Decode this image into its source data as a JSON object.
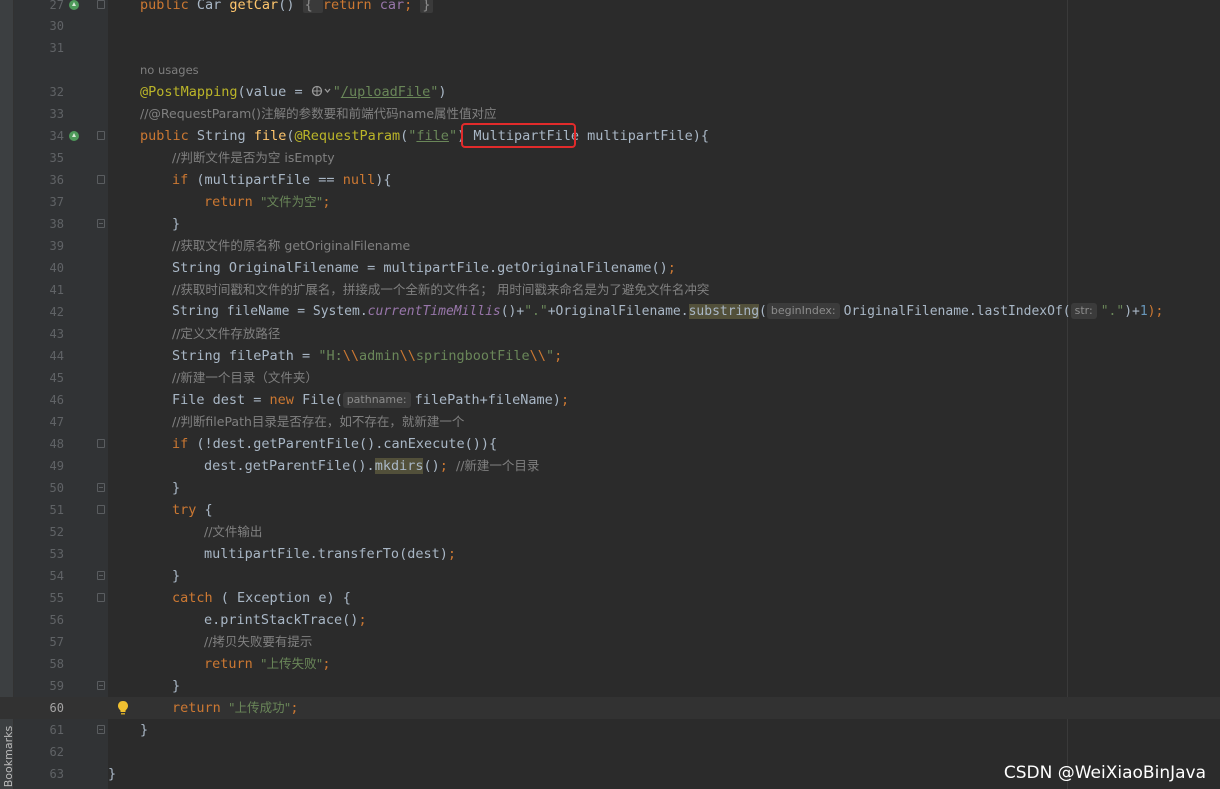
{
  "sidebar": {
    "bookmarks_label": "Bookmarks"
  },
  "code": {
    "usage_hint": "no usages",
    "lines": [
      {
        "num": "27",
        "text": "public Car getCar() { return car; }"
      },
      {
        "num": "30",
        "text": ""
      },
      {
        "num": "31",
        "text": ""
      },
      {
        "num": "32",
        "text": "@PostMapping(value = \"/uploadFile\")"
      },
      {
        "num": "33",
        "text": "//@RequestParam()注解的参数要和前端代码name属性值对应"
      },
      {
        "num": "34",
        "text": "public String file(@RequestParam(\"file\") MultipartFile multipartFile){"
      },
      {
        "num": "35",
        "text": "//判断文件是否为空 isEmpty"
      },
      {
        "num": "36",
        "text": "if (multipartFile == null){"
      },
      {
        "num": "37",
        "text": "return \"文件为空\";"
      },
      {
        "num": "38",
        "text": "}"
      },
      {
        "num": "39",
        "text": "//获取文件的原名称 getOriginalFilename"
      },
      {
        "num": "40",
        "text": "String OriginalFilename = multipartFile.getOriginalFilename();"
      },
      {
        "num": "41",
        "text": "//获取时间戳和文件的扩展名，拼接成一个全新的文件名； 用时间戳来命名是为了避免文件名冲突"
      },
      {
        "num": "42",
        "text": "String fileName = System.currentTimeMillis()+\".\"+OriginalFilename.substring(beginIndex: OriginalFilename.lastIndexOf(str: \".\")+1);"
      },
      {
        "num": "43",
        "text": "//定义文件存放路径"
      },
      {
        "num": "44",
        "text": "String filePath = \"H:\\\\admin\\\\springbootFile\\\\\";"
      },
      {
        "num": "45",
        "text": "//新建一个目录（文件夹）"
      },
      {
        "num": "46",
        "text": "File dest = new File(pathname: filePath+fileName);"
      },
      {
        "num": "47",
        "text": "//判断filePath目录是否存在，如不存在，就新建一个"
      },
      {
        "num": "48",
        "text": "if (!dest.getParentFile().canExecute()){"
      },
      {
        "num": "49",
        "text": "dest.getParentFile().mkdirs(); //新建一个目录"
      },
      {
        "num": "50",
        "text": "}"
      },
      {
        "num": "51",
        "text": "try {"
      },
      {
        "num": "52",
        "text": "//文件输出"
      },
      {
        "num": "53",
        "text": "multipartFile.transferTo(dest);"
      },
      {
        "num": "54",
        "text": "}"
      },
      {
        "num": "55",
        "text": "catch ( Exception e) {"
      },
      {
        "num": "56",
        "text": "e.printStackTrace();"
      },
      {
        "num": "57",
        "text": "//拷贝失败要有提示"
      },
      {
        "num": "58",
        "text": "return \"上传失败\";"
      },
      {
        "num": "59",
        "text": "}"
      },
      {
        "num": "60",
        "text": "return \"上传成功\";"
      },
      {
        "num": "61",
        "text": "}"
      },
      {
        "num": "62",
        "text": ""
      },
      {
        "num": "63",
        "text": "}"
      }
    ]
  },
  "tokens": {
    "l27": {
      "a": "public ",
      "b": "Car ",
      "c": "getCar",
      "d": "() ",
      "e": "{ ",
      "f": "return ",
      "g": "car",
      "h": "; ",
      "i": "}"
    },
    "l32": {
      "a": "@PostMapping",
      "b": "(value = ",
      "c": "\"",
      "d": "/uploadFile",
      "e": "\"",
      "f": ")"
    },
    "l33": {
      "a": "//@RequestParam()注解的参数要和前端代码name属性值对应"
    },
    "l34": {
      "a": "public ",
      "b": "String ",
      "c": "file",
      "d": "(",
      "e": "@RequestParam",
      "f": "(",
      "g": "\"",
      "h": "file",
      "i": "\"",
      "j": ") ",
      "k": "MultipartFile",
      "l": " multipartFile){"
    },
    "l35": {
      "a": "//判断文件是否为空 isEmpty"
    },
    "l36": {
      "a": "if ",
      "b": "(multipartFile == ",
      "c": "null",
      "d": "){"
    },
    "l37": {
      "a": "return ",
      "b": "\"文件为空\"",
      "c": ";"
    },
    "l38": {
      "a": "}"
    },
    "l39": {
      "a": "//获取文件的原名称 getOriginalFilename"
    },
    "l40": {
      "a": "String OriginalFilename = multipartFile.getOriginalFilename()",
      "b": ";"
    },
    "l41": {
      "a": "//获取时间戳和文件的扩展名，拼接成一个全新的文件名； 用时间戳来命名是为了避免文件名冲突"
    },
    "l42": {
      "a": "String fileName = System.",
      "b": "currentTimeMillis",
      "c": "()+",
      "d": "\".\"",
      "e": "+OriginalFilename.",
      "f": "substring",
      "g": "(",
      "h": "beginIndex:",
      "i": "OriginalFilename.lastIndexOf(",
      "j": "str:",
      "k": "\".\"",
      "l": ")+",
      "m": "1",
      "n": ");"
    },
    "l44": {
      "a": "String filePath = ",
      "b": "\"H:",
      "c": "\\\\",
      "d": "admin",
      "e": "\\\\",
      "f": "springbootFile",
      "g": "\\\\",
      "h": "\"",
      "i": ";"
    },
    "l43": {
      "a": "//定义文件存放路径"
    },
    "l45": {
      "a": "//新建一个目录（文件夹）"
    },
    "l46": {
      "a": "File dest = ",
      "b": "new ",
      "c": "File(",
      "d": "pathname:",
      "e": "filePath+fileName)",
      "f": ";"
    },
    "l47": {
      "a": "//判断filePath目录是否存在，如不存在，就新建一个"
    },
    "l48": {
      "a": "if ",
      "b": "(!dest.getParentFile().canExecute()){"
    },
    "l49": {
      "a": "dest.getParentFile().",
      "b": "mkdirs",
      "c": "()",
      "d": "; ",
      "e": "//新建一个目录"
    },
    "l50": {
      "a": "}"
    },
    "l51": {
      "a": "try ",
      "b": "{"
    },
    "l52": {
      "a": "//文件输出"
    },
    "l53": {
      "a": "multipartFile.transferTo(dest)",
      "b": ";"
    },
    "l54": {
      "a": "}"
    },
    "l55": {
      "a": "catch ",
      "b": "( Exception e) {"
    },
    "l56": {
      "a": "e.printStackTrace()",
      "b": ";"
    },
    "l57": {
      "a": "//拷贝失败要有提示"
    },
    "l58": {
      "a": "return ",
      "b": "\"上传失败\"",
      "c": ";"
    },
    "l59": {
      "a": "}"
    },
    "l60": {
      "a": "return ",
      "b": "\"上传成功\"",
      "c": ";"
    },
    "l61": {
      "a": "}"
    },
    "l63": {
      "a": "}"
    }
  },
  "watermark": "CSDN @WeiXiaoBinJava",
  "colors": {
    "background": "#2b2b2b",
    "gutter": "#313335",
    "keyword": "#cc7832",
    "string": "#6a8759",
    "comment": "#808080",
    "annotation": "#bbb529",
    "method": "#ffc66d",
    "highlight_box": "#e12b2b"
  }
}
